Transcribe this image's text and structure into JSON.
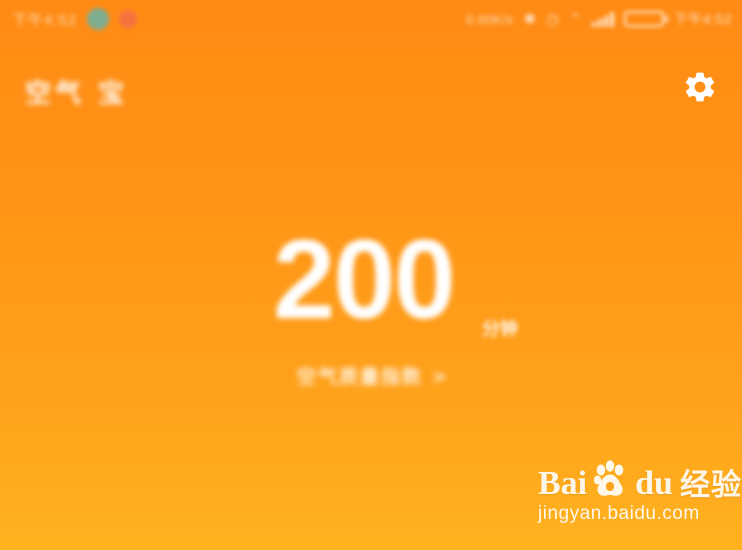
{
  "status_bar": {
    "time_left": "下午4:52",
    "net_speed": "0.00K/s",
    "clock": "下午4:52",
    "battery_level": 0.94,
    "icons": [
      "notification-dot-teal",
      "notification-dot-red",
      "bluetooth-icon",
      "alarm-icon",
      "wifi-icon",
      "signal-icon",
      "battery-icon"
    ]
  },
  "header": {
    "title": "空气 宝",
    "settings_icon": "gear-icon"
  },
  "reading": {
    "value": "200",
    "unit": "分钟",
    "subtitle": "空气质量指数 >"
  },
  "watermark": {
    "brand_left": "Bai",
    "brand_right": "du",
    "product": "经验",
    "url": "jingyan.baidu.com"
  },
  "colors": {
    "background_top": "#ff8a14",
    "background_bottom": "#ffb21f",
    "text": "#ffffff",
    "accent_teal": "#56b9b6",
    "accent_red": "#f46a4f"
  }
}
